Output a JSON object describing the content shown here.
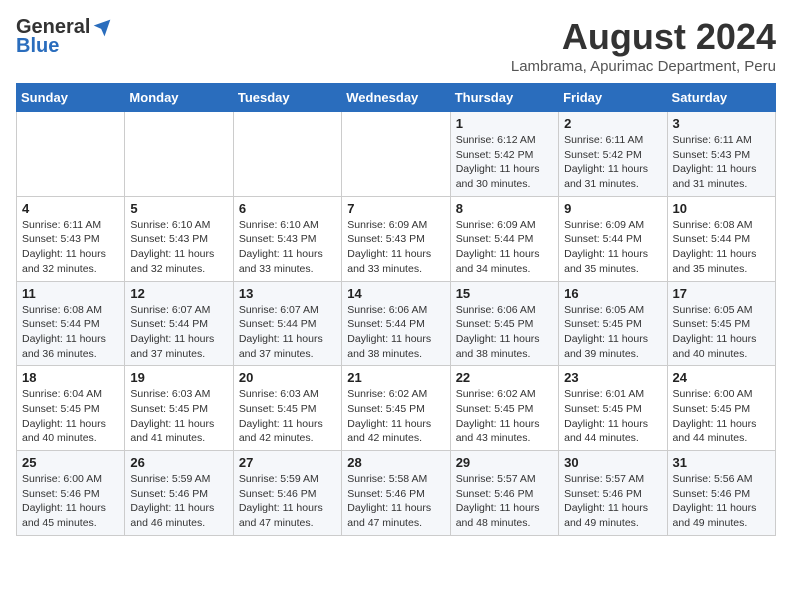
{
  "logo": {
    "general": "General",
    "blue": "Blue"
  },
  "title": {
    "month_year": "August 2024",
    "location": "Lambrama, Apurimac Department, Peru"
  },
  "days_of_week": [
    "Sunday",
    "Monday",
    "Tuesday",
    "Wednesday",
    "Thursday",
    "Friday",
    "Saturday"
  ],
  "weeks": [
    [
      {
        "day": "",
        "info": ""
      },
      {
        "day": "",
        "info": ""
      },
      {
        "day": "",
        "info": ""
      },
      {
        "day": "",
        "info": ""
      },
      {
        "day": "1",
        "info": "Sunrise: 6:12 AM\nSunset: 5:42 PM\nDaylight: 11 hours\nand 30 minutes."
      },
      {
        "day": "2",
        "info": "Sunrise: 6:11 AM\nSunset: 5:42 PM\nDaylight: 11 hours\nand 31 minutes."
      },
      {
        "day": "3",
        "info": "Sunrise: 6:11 AM\nSunset: 5:43 PM\nDaylight: 11 hours\nand 31 minutes."
      }
    ],
    [
      {
        "day": "4",
        "info": "Sunrise: 6:11 AM\nSunset: 5:43 PM\nDaylight: 11 hours\nand 32 minutes."
      },
      {
        "day": "5",
        "info": "Sunrise: 6:10 AM\nSunset: 5:43 PM\nDaylight: 11 hours\nand 32 minutes."
      },
      {
        "day": "6",
        "info": "Sunrise: 6:10 AM\nSunset: 5:43 PM\nDaylight: 11 hours\nand 33 minutes."
      },
      {
        "day": "7",
        "info": "Sunrise: 6:09 AM\nSunset: 5:43 PM\nDaylight: 11 hours\nand 33 minutes."
      },
      {
        "day": "8",
        "info": "Sunrise: 6:09 AM\nSunset: 5:44 PM\nDaylight: 11 hours\nand 34 minutes."
      },
      {
        "day": "9",
        "info": "Sunrise: 6:09 AM\nSunset: 5:44 PM\nDaylight: 11 hours\nand 35 minutes."
      },
      {
        "day": "10",
        "info": "Sunrise: 6:08 AM\nSunset: 5:44 PM\nDaylight: 11 hours\nand 35 minutes."
      }
    ],
    [
      {
        "day": "11",
        "info": "Sunrise: 6:08 AM\nSunset: 5:44 PM\nDaylight: 11 hours\nand 36 minutes."
      },
      {
        "day": "12",
        "info": "Sunrise: 6:07 AM\nSunset: 5:44 PM\nDaylight: 11 hours\nand 37 minutes."
      },
      {
        "day": "13",
        "info": "Sunrise: 6:07 AM\nSunset: 5:44 PM\nDaylight: 11 hours\nand 37 minutes."
      },
      {
        "day": "14",
        "info": "Sunrise: 6:06 AM\nSunset: 5:44 PM\nDaylight: 11 hours\nand 38 minutes."
      },
      {
        "day": "15",
        "info": "Sunrise: 6:06 AM\nSunset: 5:45 PM\nDaylight: 11 hours\nand 38 minutes."
      },
      {
        "day": "16",
        "info": "Sunrise: 6:05 AM\nSunset: 5:45 PM\nDaylight: 11 hours\nand 39 minutes."
      },
      {
        "day": "17",
        "info": "Sunrise: 6:05 AM\nSunset: 5:45 PM\nDaylight: 11 hours\nand 40 minutes."
      }
    ],
    [
      {
        "day": "18",
        "info": "Sunrise: 6:04 AM\nSunset: 5:45 PM\nDaylight: 11 hours\nand 40 minutes."
      },
      {
        "day": "19",
        "info": "Sunrise: 6:03 AM\nSunset: 5:45 PM\nDaylight: 11 hours\nand 41 minutes."
      },
      {
        "day": "20",
        "info": "Sunrise: 6:03 AM\nSunset: 5:45 PM\nDaylight: 11 hours\nand 42 minutes."
      },
      {
        "day": "21",
        "info": "Sunrise: 6:02 AM\nSunset: 5:45 PM\nDaylight: 11 hours\nand 42 minutes."
      },
      {
        "day": "22",
        "info": "Sunrise: 6:02 AM\nSunset: 5:45 PM\nDaylight: 11 hours\nand 43 minutes."
      },
      {
        "day": "23",
        "info": "Sunrise: 6:01 AM\nSunset: 5:45 PM\nDaylight: 11 hours\nand 44 minutes."
      },
      {
        "day": "24",
        "info": "Sunrise: 6:00 AM\nSunset: 5:45 PM\nDaylight: 11 hours\nand 44 minutes."
      }
    ],
    [
      {
        "day": "25",
        "info": "Sunrise: 6:00 AM\nSunset: 5:46 PM\nDaylight: 11 hours\nand 45 minutes."
      },
      {
        "day": "26",
        "info": "Sunrise: 5:59 AM\nSunset: 5:46 PM\nDaylight: 11 hours\nand 46 minutes."
      },
      {
        "day": "27",
        "info": "Sunrise: 5:59 AM\nSunset: 5:46 PM\nDaylight: 11 hours\nand 47 minutes."
      },
      {
        "day": "28",
        "info": "Sunrise: 5:58 AM\nSunset: 5:46 PM\nDaylight: 11 hours\nand 47 minutes."
      },
      {
        "day": "29",
        "info": "Sunrise: 5:57 AM\nSunset: 5:46 PM\nDaylight: 11 hours\nand 48 minutes."
      },
      {
        "day": "30",
        "info": "Sunrise: 5:57 AM\nSunset: 5:46 PM\nDaylight: 11 hours\nand 49 minutes."
      },
      {
        "day": "31",
        "info": "Sunrise: 5:56 AM\nSunset: 5:46 PM\nDaylight: 11 hours\nand 49 minutes."
      }
    ]
  ]
}
